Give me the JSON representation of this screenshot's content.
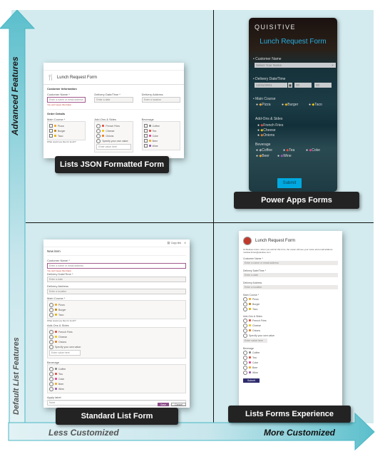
{
  "axes": {
    "y_top_label": "Advanced Features",
    "y_bottom_label": "Default List Features",
    "x_left_label": "Less Customized",
    "x_right_label": "More Customized",
    "arrow_color": "#5bbfcc",
    "background_color": "#d3ebef"
  },
  "quadrants": {
    "top_left": {
      "label": "Lists JSON Formatted Form",
      "form": {
        "title": "Lunch Request Form",
        "section_customer": "Customer Information",
        "fields": [
          {
            "label": "Customer Name *",
            "placeholder": "Enter a name or email address",
            "error": "You can't leave this blank."
          },
          {
            "label": "Delivery Date/Time *",
            "placeholder": "Enter a date"
          },
          {
            "label": "Delivery Address",
            "placeholder": "Enter a location"
          }
        ],
        "section_order": "Order Details",
        "main_course": {
          "label": "Main Course *",
          "options": [
            "Pizza",
            "Burger",
            "Taco"
          ],
          "hint": "What would you like for lunch?"
        },
        "addons": {
          "label": "Add-Ons & Sides",
          "options": [
            "French Fries",
            "Cheese",
            "Onions",
            "Specify your own value:"
          ],
          "custom_placeholder": "Enter value here"
        },
        "beverage": {
          "label": "Beverage",
          "options": [
            "Coffee",
            "Tea",
            "Coke",
            "Beer",
            "Wine"
          ]
        }
      }
    },
    "top_right": {
      "label": "Power Apps Forms",
      "form": {
        "brand": "QUISITIVE",
        "title": "Lunch Request Form",
        "customer_name_label": "Customer Name",
        "customer_name_placeholder": "Select Your Name",
        "delivery_label": "Delivery Date/Time",
        "delivery_date": "12/31/2001",
        "hour": "00",
        "minute": "00",
        "main_course_label": "Main Course",
        "main_course_options": [
          "Pizza",
          "Burger",
          "Taco"
        ],
        "addons_label": "Add-Ons & Sides",
        "addons_options": [
          "French Fries",
          "Cheese",
          "Onions"
        ],
        "beverage_label": "Beverage",
        "beverage_options": [
          "Coffee",
          "Tea",
          "Coke",
          "Beer",
          "Wine"
        ],
        "submit": "Submit"
      }
    },
    "bottom_left": {
      "label": "Standard List Form",
      "form": {
        "copy_link": "Copy link",
        "header": "New item",
        "fields": [
          {
            "label": "Customer Name *",
            "placeholder": "Enter a name or email address",
            "error": "You can't leave this blank."
          },
          {
            "label": "Delivery Date/Time *",
            "placeholder": "Enter a date"
          },
          {
            "label": "Delivery Address",
            "placeholder": "Enter a location"
          }
        ],
        "main_course": {
          "label": "Main Course *",
          "options": [
            "Pizza",
            "Burger",
            "Taco"
          ],
          "hint": "What would you like for lunch?"
        },
        "addons": {
          "label": "Add-Ons & Sides",
          "options": [
            "French Fries",
            "Cheese",
            "Onions",
            "Specify your own value:"
          ],
          "custom_placeholder": "Enter value here"
        },
        "beverage": {
          "label": "Beverage",
          "options": [
            "Coffee",
            "Tea",
            "Coke",
            "Beer",
            "Wine"
          ]
        },
        "apply_label": {
          "label": "Apply label",
          "value": "None"
        },
        "save": "Save",
        "cancel": "Cancel"
      }
    },
    "bottom_right": {
      "label": "Lists Forms Experience",
      "form": {
        "title": "Lunch Request Form",
        "intro": "Hi Melissa Linton, when you submit this form, the owner will see your name and email address.",
        "email": "melissa.linton@quisitive.com",
        "fields": [
          {
            "label": "Customer Name *",
            "placeholder": "Enter a name or email address"
          },
          {
            "label": "Delivery Date/Time *",
            "placeholder": "Enter a date"
          },
          {
            "label": "Delivery Address",
            "placeholder": "Enter a location"
          }
        ],
        "main_course": {
          "label": "Main Course *",
          "options": [
            "Pizza",
            "Burger",
            "Taco"
          ]
        },
        "addons": {
          "label": "Add-Ons & Sides",
          "options": [
            "French Fries",
            "Cheese",
            "Onions",
            "Specify your own value"
          ],
          "custom_placeholder": "Enter value here"
        },
        "beverage": {
          "label": "Beverage",
          "options": [
            "Coffee",
            "Tea",
            "Coke",
            "Beer",
            "Wine"
          ]
        },
        "submit": "Submit"
      }
    }
  }
}
